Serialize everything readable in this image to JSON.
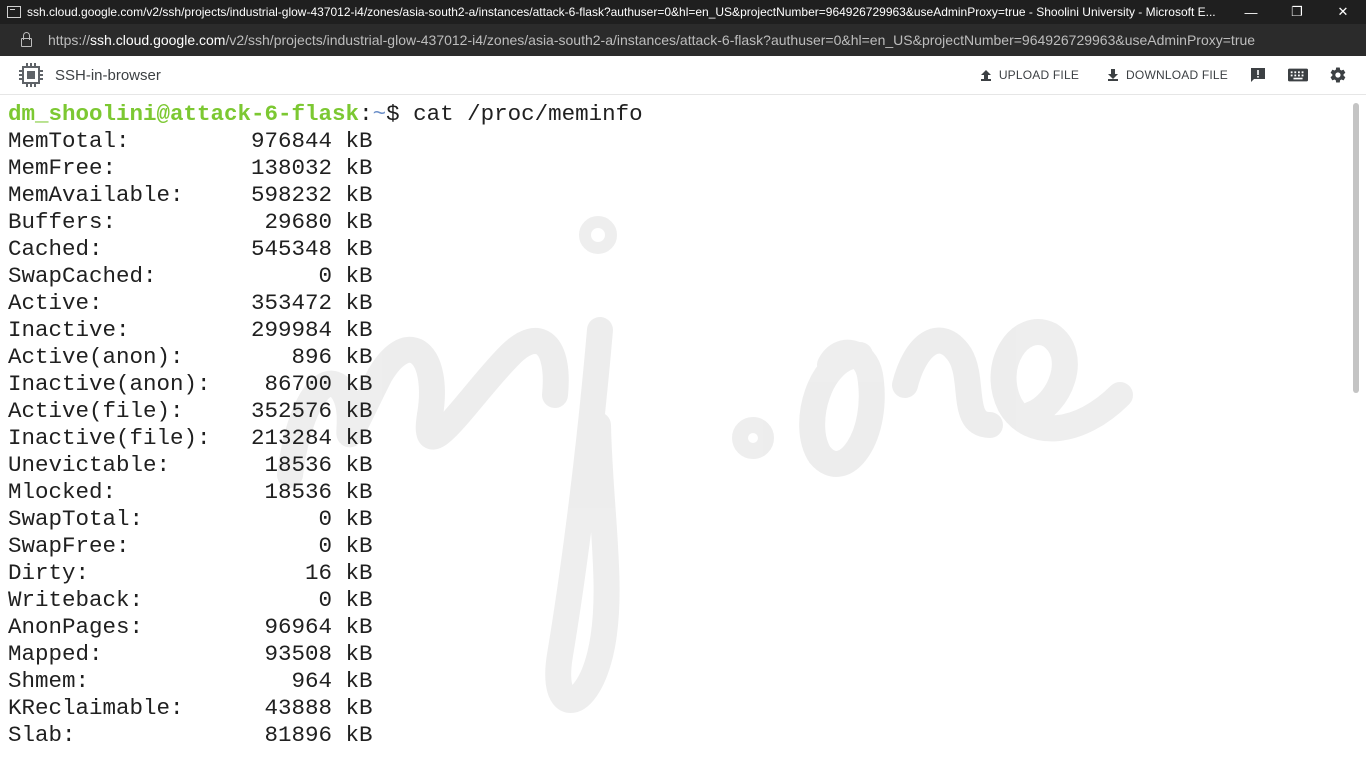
{
  "window": {
    "title": "ssh.cloud.google.com/v2/ssh/projects/industrial-glow-437012-i4/zones/asia-south2-a/instances/attack-6-flask?authuser=0&hl=en_US&projectNumber=964926729963&useAdminProxy=true - Shoolini University - Microsoft E...",
    "controls": {
      "minimize": "—",
      "restore": "❐",
      "close": "✕"
    }
  },
  "address_bar": {
    "scheme": "https://",
    "host": "ssh.cloud.google.com",
    "path": "/v2/ssh/projects/industrial-glow-437012-i4/zones/asia-south2-a/instances/attack-6-flask?authuser=0&hl=en_US&projectNumber=964926729963&useAdminProxy=true"
  },
  "toolbar": {
    "app_name": "SSH-in-browser",
    "upload_label": "UPLOAD FILE",
    "download_label": "DOWNLOAD FILE",
    "icons": [
      "chip-icon",
      "upload-icon",
      "download-icon",
      "feedback-icon",
      "keyboard-icon",
      "settings-icon"
    ]
  },
  "terminal": {
    "prompt_user": "dm_shoolini@attack-6-flask",
    "prompt_colon": ":",
    "prompt_path": "~",
    "prompt_symbol": "$ ",
    "command": "cat /proc/meminfo",
    "lines": [
      "MemTotal:         976844 kB",
      "MemFree:          138032 kB",
      "MemAvailable:     598232 kB",
      "Buffers:           29680 kB",
      "Cached:           545348 kB",
      "SwapCached:            0 kB",
      "Active:           353472 kB",
      "Inactive:         299984 kB",
      "Active(anon):        896 kB",
      "Inactive(anon):    86700 kB",
      "Active(file):     352576 kB",
      "Inactive(file):   213284 kB",
      "Unevictable:       18536 kB",
      "Mlocked:           18536 kB",
      "SwapTotal:             0 kB",
      "SwapFree:              0 kB",
      "Dirty:                16 kB",
      "Writeback:             0 kB",
      "AnonPages:         96964 kB",
      "Mapped:            93508 kB",
      "Shmem:               964 kB",
      "KReclaimable:      43888 kB",
      "Slab:              81896 kB"
    ]
  },
  "watermark": {
    "text": "mj.one"
  },
  "colors": {
    "prompt_user": "#7cc832",
    "prompt_path": "#6a8ec8",
    "terminal_text": "#202020",
    "titlebar_bg": "#1f1f1f",
    "addressbar_bg": "#2b2b2b"
  }
}
